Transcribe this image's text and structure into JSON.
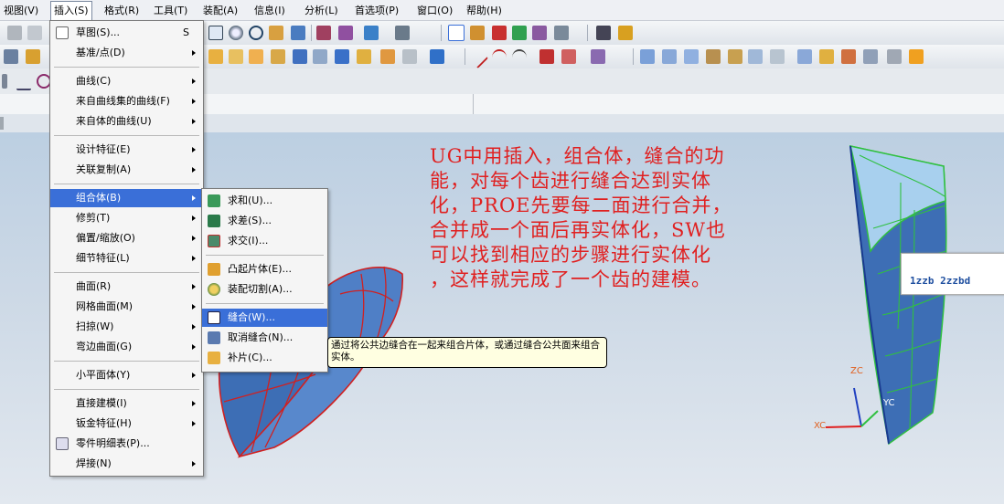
{
  "menubar": {
    "items": [
      "视图(V)",
      "插入(S)",
      "格式(R)",
      "工具(T)",
      "装配(A)",
      "信息(I)",
      "分析(L)",
      "首选项(P)",
      "窗口(O)",
      "帮助(H)"
    ],
    "active_index": 1
  },
  "insert_menu": {
    "items": [
      {
        "label": "草图(S)...",
        "shortcut": "S",
        "submenu": false,
        "icon": "sketch-icon"
      },
      {
        "label": "基准/点(D)",
        "submenu": true
      },
      {
        "label": "曲线(C)",
        "submenu": true
      },
      {
        "label": "来自曲线集的曲线(F)",
        "submenu": true
      },
      {
        "label": "来自体的曲线(U)",
        "submenu": true
      },
      {
        "label": "设计特征(E)",
        "submenu": true
      },
      {
        "label": "关联复制(A)",
        "submenu": true
      },
      {
        "label": "组合体(B)",
        "submenu": true,
        "highlighted": true
      },
      {
        "label": "修剪(T)",
        "submenu": true
      },
      {
        "label": "偏置/缩放(O)",
        "submenu": true
      },
      {
        "label": "细节特征(L)",
        "submenu": true
      },
      {
        "label": "曲面(R)",
        "submenu": true
      },
      {
        "label": "网格曲面(M)",
        "submenu": true
      },
      {
        "label": "扫掠(W)",
        "submenu": true
      },
      {
        "label": "弯边曲面(G)",
        "submenu": true
      },
      {
        "label": "小平面体(Y)",
        "submenu": true
      },
      {
        "label": "直接建模(I)",
        "submenu": true
      },
      {
        "label": "钣金特征(H)",
        "submenu": true
      },
      {
        "label": "零件明细表(P)...",
        "submenu": false,
        "icon": "parts-list-icon"
      },
      {
        "label": "焊接(N)",
        "submenu": true
      }
    ]
  },
  "combine_submenu": {
    "items": [
      {
        "label": "求和(U)...",
        "icon": "unite-icon"
      },
      {
        "label": "求差(S)...",
        "icon": "subtract-icon"
      },
      {
        "label": "求交(I)...",
        "icon": "intersect-icon"
      },
      {
        "label": "凸起片体(E)...",
        "icon": "emboss-sheet-icon"
      },
      {
        "label": "装配切割(A)...",
        "icon": "assembly-cut-icon"
      },
      {
        "label": "缝合(W)...",
        "icon": "sew-icon",
        "highlighted": true
      },
      {
        "label": "取消缝合(N)...",
        "icon": "unsew-icon"
      },
      {
        "label": "补片(C)...",
        "icon": "patch-icon"
      }
    ]
  },
  "tooltip": {
    "text": "通过将公共边缝合在一起来组合片体，或通过缝合公共面来组合实体。"
  },
  "annotation": {
    "lines": [
      "UG中用插入，组合体，缝合的功",
      "能，对每个齿进行缝合达到实体",
      "化，PROE先要每二面进行合并，",
      "合并成一个面后再实体化，SW也",
      "可以找到相应的步骤进行实体化",
      "，这样就完成了一个齿的建模。"
    ],
    "color": "#e02020"
  },
  "infobox": {
    "text": "1zzb 2zzbd"
  },
  "axes": {
    "z_label": "ZC",
    "x_label": "XC",
    "y_label": "YC"
  },
  "colors": {
    "menu_highlight": "#3a6fd8",
    "surface_blue": "#4d7fc8",
    "edge_red": "#e02020",
    "edge_green": "#30c040"
  }
}
